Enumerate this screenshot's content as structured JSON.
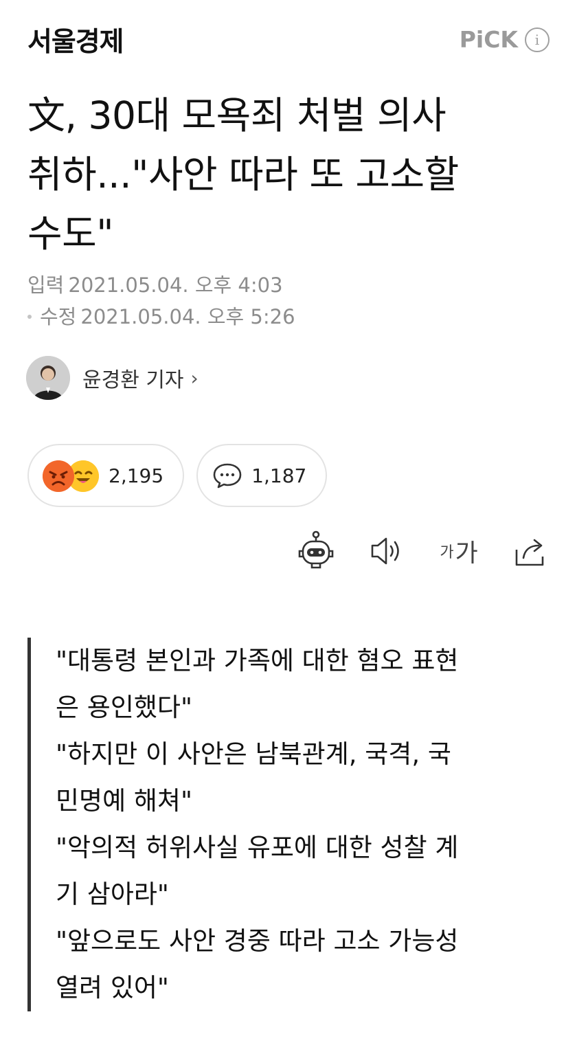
{
  "header": {
    "press_name": "서울경제",
    "pick_label": "PiCK",
    "info_symbol": "i"
  },
  "article": {
    "headline_lines": [
      "文, 30대 모욕죄 처벌 의사",
      "취하...\"사안 따라 또 고소할",
      "수도\""
    ],
    "published_label": "입력",
    "published_value": "2021.05.04. 오후 4:03",
    "modified_label": "수정",
    "modified_value": "2021.05.04. 오후 5:26"
  },
  "reporter": {
    "name": "윤경환 기자",
    "chevron": "›"
  },
  "reactions": {
    "emoji_icons": [
      "angry-face-icon",
      "happy-face-icon"
    ],
    "reaction_count": "2,195",
    "comment_count": "1,187"
  },
  "toolbar": {
    "icons": [
      "robot-summary-icon",
      "speaker-icon",
      "font-size-icon",
      "share-icon"
    ],
    "font_small": "가",
    "font_large": "가"
  },
  "quote_lines": [
    "\"대통령 본인과 가족에 대한 혐오 표현",
    "은 용인했다\"",
    "\"하지만 이 사안은 남북관계, 국격, 국",
    "민명예 해쳐\"",
    "\"악의적 허위사실 유포에 대한 성찰 계",
    "기 삼아라\"",
    "\"앞으로도 사안 경중 따라 고소 가능성",
    "열려 있어\""
  ],
  "colors": {
    "text": "#111111",
    "meta": "#8c8c8c",
    "pick": "#9a9a9a",
    "angry": "#f2662a",
    "happy": "#ffc629",
    "border": "#e3e3e3"
  }
}
